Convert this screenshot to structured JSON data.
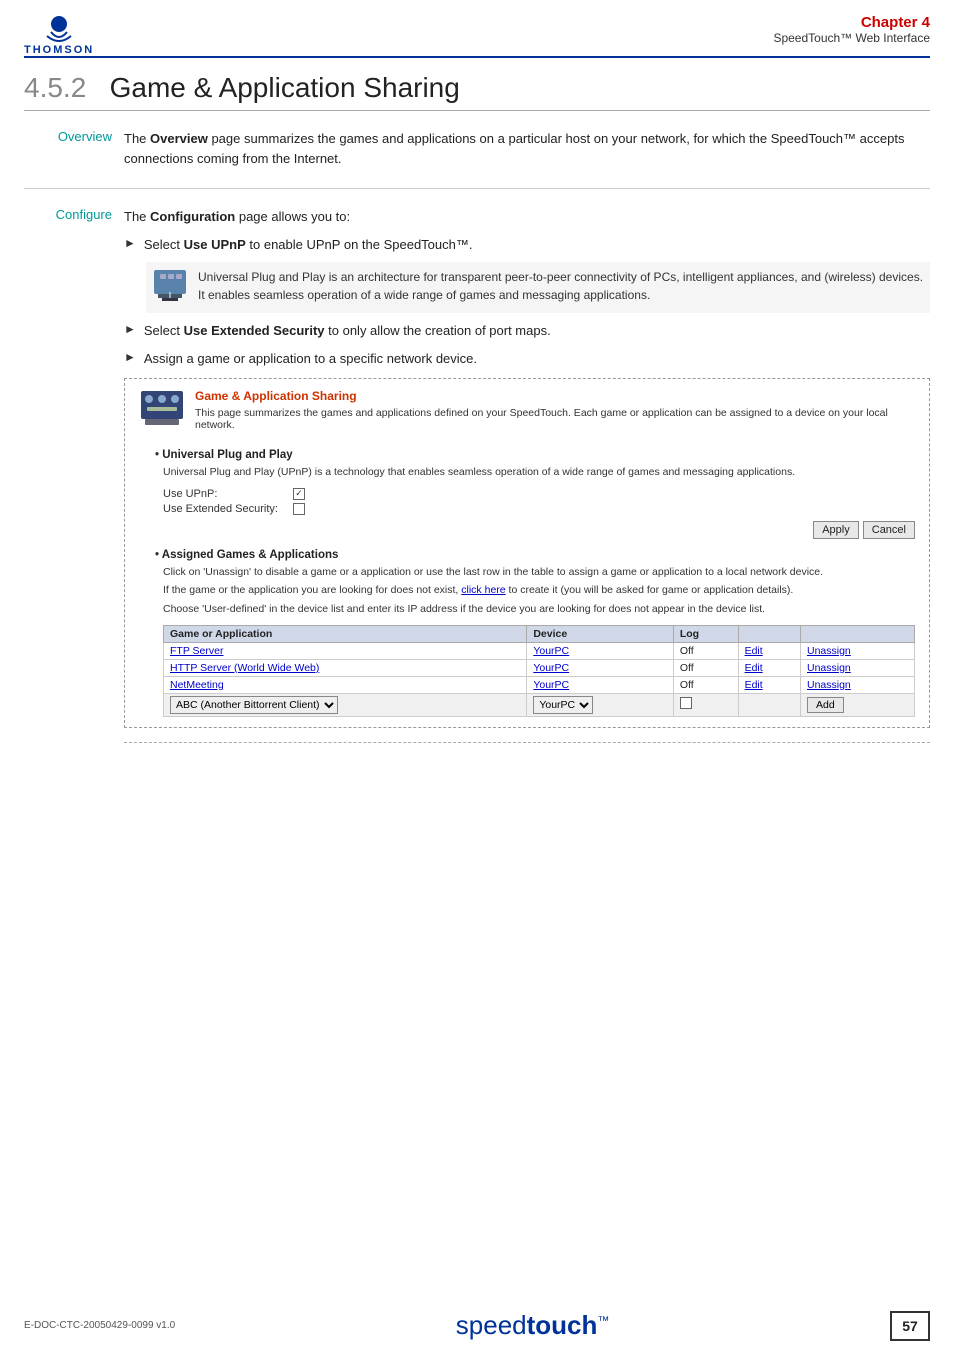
{
  "header": {
    "logo_text": "THOMSON",
    "chapter_label": "Chapter 4",
    "chapter_sub": "SpeedTouch™ Web Interface"
  },
  "title": {
    "chapter_num": "4.5.2",
    "title_text": "Game & Application Sharing"
  },
  "overview": {
    "label": "Overview",
    "paragraph": "The Overview page summarizes the games and applications on a particular host on your network, for which the SpeedTouch™ accepts connections coming from the Internet."
  },
  "configure": {
    "label": "Configure",
    "intro": "The Configuration page allows you to:",
    "bullets": [
      {
        "id": "bullet1",
        "text": "Select Use UPnP to enable UPnP on the SpeedTouch™."
      },
      {
        "id": "bullet2",
        "text": "Select Use Extended Security to only allow the creation of port maps."
      },
      {
        "id": "bullet3",
        "text": "Assign a game or application to a specific network device."
      }
    ],
    "upnp_note": "Universal Plug and Play is an architecture for transparent peer-to-peer connectivity of PCs, intelligent appliances, and (wireless) devices. It enables seamless operation of a wide range of games and messaging applications.",
    "screenshot": {
      "title": "Game & Application Sharing",
      "desc": "This page summarizes the games and applications defined on your SpeedTouch. Each game or application can be assigned to a device on your local network.",
      "upnp_section_title": "Universal Plug and Play",
      "upnp_desc": "Universal Plug and Play (UPnP) is a technology that enables seamless operation of a wide range of games and messaging applications.",
      "form_rows": [
        {
          "label": "Use UPnP:",
          "checked": true
        },
        {
          "label": "Use Extended Security:",
          "checked": false
        }
      ],
      "apply_btn": "Apply",
      "cancel_btn": "Cancel",
      "assigned_title": "Assigned Games & Applications",
      "assigned_desc1": "Click on 'Unassign' to disable a game or a application or use the last row in the table to assign a game or application to a local network device.",
      "assigned_desc2": "If the game or the application you are looking for does not exist, click here to create it (you will be asked for game or application details).",
      "assigned_desc3": "Choose 'User-defined' in the device list and enter its IP address if the device you are looking for does not appear in the device list.",
      "table_headers": [
        "Game or Application",
        "Device",
        "Log",
        "",
        ""
      ],
      "table_rows": [
        {
          "app": "FTP Server",
          "device": "YourPC",
          "log": "Off",
          "action1": "Edit",
          "action2": "Unassign"
        },
        {
          "app": "HTTP Server (World Wide Web)",
          "device": "YourPC",
          "log": "Off",
          "action1": "Edit",
          "action2": "Unassign"
        },
        {
          "app": "NetMeeting",
          "device": "YourPC",
          "log": "Off",
          "action1": "Edit",
          "action2": "Unassign"
        }
      ],
      "add_row": {
        "app_default": "ABC (Another Bittorrent Client)",
        "device_default": "YourPC",
        "log_checked": false,
        "add_btn": "Add"
      }
    }
  },
  "footer": {
    "doc_id": "E-DOC-CTC-20050429-0099 v1.0",
    "logo_speed": "speed",
    "logo_touch": "touch",
    "logo_tm": "™",
    "page_number": "57"
  }
}
